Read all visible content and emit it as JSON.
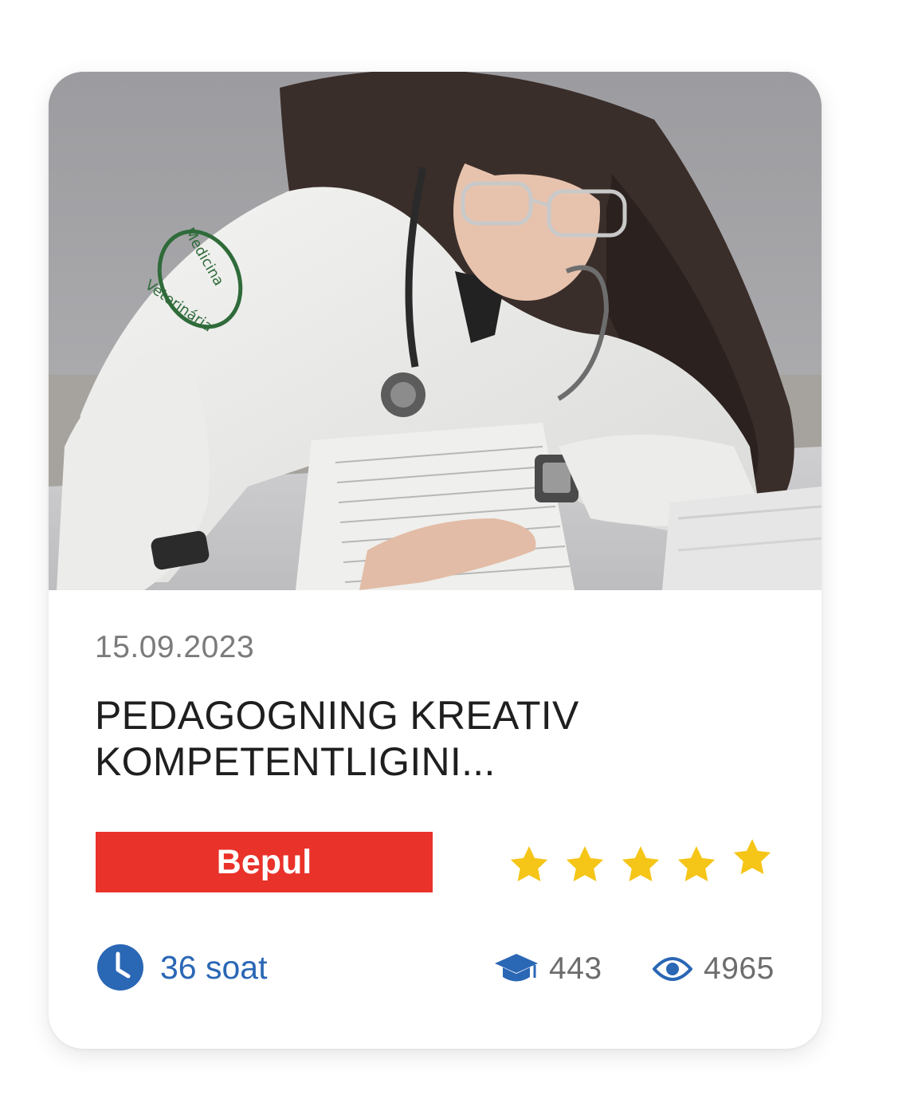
{
  "course_card": {
    "image": {
      "alt": "",
      "sleeve_text_1": "Medicina",
      "sleeve_text_2": "Veterinária"
    },
    "date": "15.09.2023",
    "title_line1": "PEDAGOGNING KREATIV",
    "title_line2": "KOMPETENTLIGINI...",
    "price_label": "Bepul",
    "rating": 5,
    "rating_max": 5,
    "duration": "36 soat",
    "students_count": "443",
    "views_count": "4965",
    "icons": {
      "duration": "clock-icon",
      "students": "graduation-cap-icon",
      "views": "eye-icon",
      "rating": "star-icon"
    },
    "colors": {
      "price_badge": "#e9322a",
      "accent_blue": "#2a67b5",
      "star": "#f5c518",
      "muted_text": "#7b7b7b"
    }
  }
}
